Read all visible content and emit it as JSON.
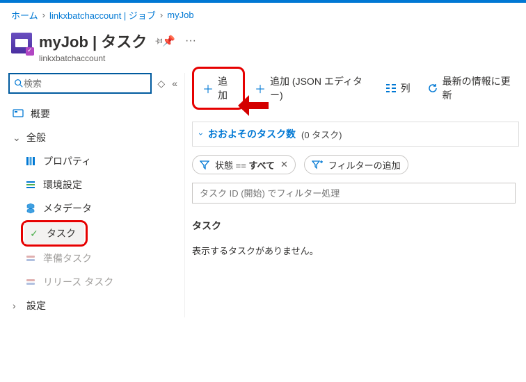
{
  "breadcrumb": {
    "home": "ホーム",
    "account": "linkxbatchaccount | ジョブ",
    "job": "myJob"
  },
  "header": {
    "title": "myJob | タスク",
    "subtitle": "linkxbatchaccount"
  },
  "sidebar": {
    "search_placeholder": "検索",
    "overview": "概要",
    "group_general": "全般",
    "items": {
      "properties": "プロパティ",
      "env": "環境設定",
      "metadata": "メタデータ",
      "tasks": "タスク",
      "prep": "準備タスク",
      "release": "リリース タスク"
    },
    "group_settings": "設定"
  },
  "toolbar": {
    "add": "追加",
    "add_json": "追加 (JSON エディター)",
    "columns": "列",
    "refresh": "最新の情報に更新"
  },
  "approx": {
    "label": "おおよそのタスク数",
    "count": "(0 タスク)"
  },
  "chips": {
    "state_label": "状態 == ",
    "state_value": "すべて",
    "add_filter": "フィルターの追加"
  },
  "filter": {
    "placeholder": "タスク ID (開始) でフィルター処理"
  },
  "tasks": {
    "heading": "タスク",
    "empty": "表示するタスクがありません。"
  }
}
